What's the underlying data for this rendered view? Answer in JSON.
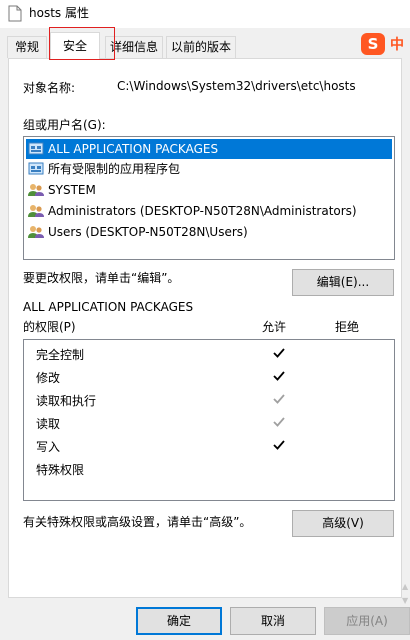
{
  "window": {
    "title": "hosts 属性"
  },
  "tabs": [
    {
      "label": "常规"
    },
    {
      "label": "安全"
    },
    {
      "label": "详细信息"
    },
    {
      "label": "以前的版本"
    }
  ],
  "ime_badge": {
    "logo_letter": "S",
    "text": "中"
  },
  "security": {
    "object_name_label": "对象名称:",
    "object_name_value": "C:\\Windows\\System32\\drivers\\etc\\hosts",
    "group_label": "组或用户名(G):",
    "groups": [
      {
        "name": "ALL APPLICATION PACKAGES",
        "icon": "app-package-icon",
        "selected": true
      },
      {
        "name": "所有受限制的应用程序包",
        "icon": "app-package-icon",
        "selected": false
      },
      {
        "name": "SYSTEM",
        "icon": "user-group-icon",
        "selected": false
      },
      {
        "name": "Administrators (DESKTOP-N50T28N\\Administrators)",
        "icon": "user-group-icon",
        "selected": false
      },
      {
        "name": "Users (DESKTOP-N50T28N\\Users)",
        "icon": "user-group-icon",
        "selected": false
      }
    ],
    "edit_hint": "要更改权限，请单击“编辑”。",
    "edit_button": "编辑(E)...",
    "perm_for_line1": "ALL APPLICATION PACKAGES",
    "perm_for_line2": "的权限(P)",
    "allow_header": "允许",
    "deny_header": "拒绝",
    "permissions": [
      {
        "name": "完全控制",
        "allow": "checked"
      },
      {
        "name": "修改",
        "allow": "checked"
      },
      {
        "name": "读取和执行",
        "allow": "grey"
      },
      {
        "name": "读取",
        "allow": "grey"
      },
      {
        "name": "写入",
        "allow": "checked"
      },
      {
        "name": "特殊权限",
        "allow": "none"
      }
    ],
    "advanced_hint": "有关特殊权限或高级设置，请单击“高级”。",
    "advanced_button": "高级(V)"
  },
  "footer": {
    "ok_label": "确定",
    "cancel_label": "取消",
    "apply_label": "应用(A)"
  },
  "colors": {
    "selection": "#0078d7",
    "highlight_box": "#e02020",
    "brand": "#ff5722"
  }
}
